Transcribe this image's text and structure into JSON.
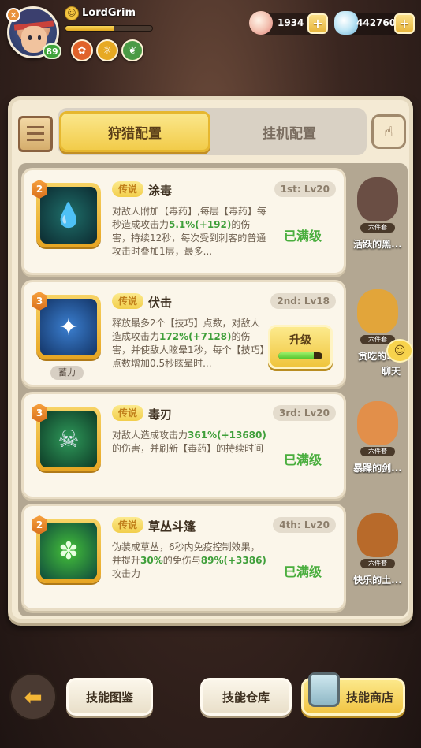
{
  "player": {
    "name": "LordGrim",
    "level": "89",
    "xp_progress": 0.55
  },
  "currency": {
    "shells": "1934",
    "diamonds": "442760"
  },
  "tabs": [
    "狩猎配置",
    "挂机配置"
  ],
  "skills": [
    {
      "rank": "2",
      "tag": "传说",
      "name": "涂毒",
      "slot": "1st: Lv20",
      "desc_parts": [
        "对敌人附加【毒药】,每层【毒药】每秒造成攻击力",
        "5.1%(+192)",
        "的伤害，持续12秒，每次受到刺客的普通攻击时叠加1层，最多..."
      ],
      "status": "已满级"
    },
    {
      "rank": "3",
      "tag": "传说",
      "name": "伏击",
      "slot": "2nd: Lv18",
      "stored": "蓄力",
      "desc_parts": [
        "释放最多2个【技巧】点数，对敌人造成攻击力",
        "172%(+7128)",
        "的伤害，并使敌人眩晕1秒，每个【技巧】点数增加0.5秒眩晕时..."
      ],
      "upgrade": "升级",
      "upgrade_progress": 0.8
    },
    {
      "rank": "3",
      "tag": "传说",
      "name": "毒刃",
      "slot": "3rd: Lv20",
      "desc_parts": [
        "对敌人造成攻击力",
        "361%(+13680)",
        "的伤害，并刷新【毒药】的持续时间"
      ],
      "status": "已满级"
    },
    {
      "rank": "2",
      "tag": "传说",
      "name": "草丛斗篷",
      "slot": "4th: Lv20",
      "desc_parts": [
        "伪装成草丛，6秒内免疫控制效果，并提升",
        "30%",
        "的免伤与",
        "89%(+3386)",
        "攻击力"
      ],
      "status": "已满级"
    }
  ],
  "pets": [
    {
      "name": "活跃的黑...",
      "tag": "六件套",
      "color": "#6a4e44"
    },
    {
      "name": "贪吃的...",
      "tag": "六件套",
      "color": "#e2a53a"
    },
    {
      "name": "暴躁的剑...",
      "tag": "六件套",
      "color": "#e28f4a"
    },
    {
      "name": "快乐的土...",
      "tag": "六件套",
      "color": "#b86a2a"
    }
  ],
  "chat_label": "聊天",
  "bottom": {
    "book": "技能图鉴",
    "warehouse": "技能仓库",
    "shop": "技能商店"
  }
}
